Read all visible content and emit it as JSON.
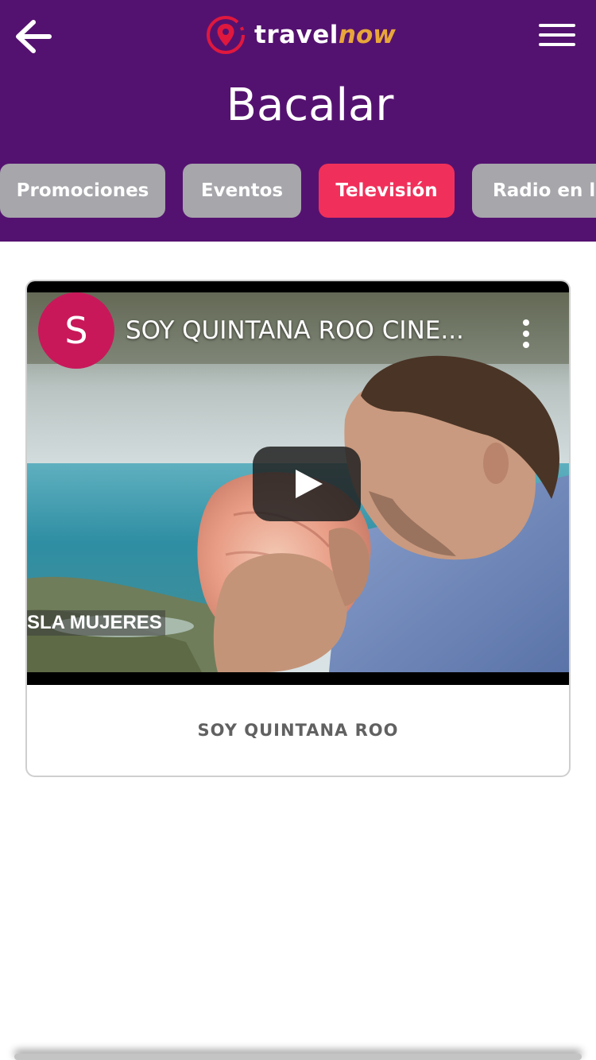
{
  "header": {
    "back_icon": "arrow-left-icon",
    "logo": {
      "icon": "map-pin-icon",
      "text_primary": "travel",
      "text_accent": "now",
      "accent_color": "#e8a63a",
      "pin_color": "#e0183e"
    },
    "menu_icon": "hamburger-menu-icon",
    "title": "Bacalar",
    "background_color": "#541270"
  },
  "tabs": [
    {
      "label": "Promociones",
      "active": false
    },
    {
      "label": "Eventos",
      "active": false
    },
    {
      "label": "Televisión",
      "active": true
    },
    {
      "label": "Radio en lín",
      "active": false
    }
  ],
  "tab_colors": {
    "inactive": "#a6a6ab",
    "active": "#f0305a"
  },
  "video_card": {
    "channel_initial": "S",
    "channel_avatar_color": "#c8185a",
    "video_title": "SOY QUINTANA ROO CINE...",
    "more_icon": "vertical-dots-icon",
    "play_icon": "youtube-play-icon",
    "location_caption": "SLA MUJERES",
    "caption": "SOY QUINTANA ROO"
  }
}
